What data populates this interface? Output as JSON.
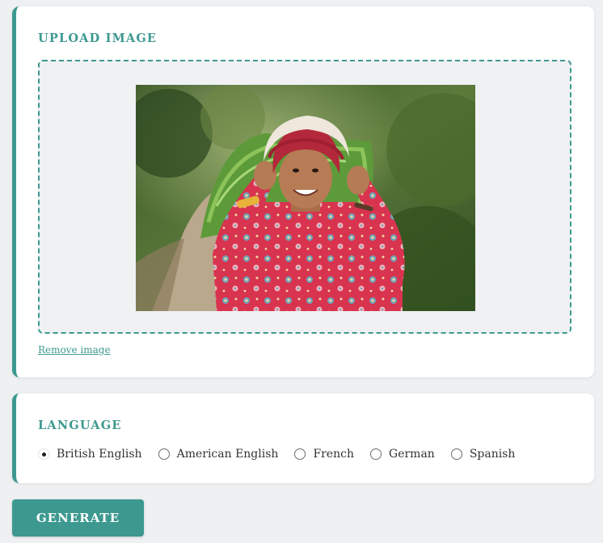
{
  "upload": {
    "title": "UPLOAD IMAGE",
    "image_alt": "Smiling woman in red floral dress and headscarf carrying a bundle of green grass on her back on a dirt path",
    "remove_label": "Remove image"
  },
  "language": {
    "title": "LANGUAGE",
    "selected": "British English",
    "options": [
      {
        "label": "British English",
        "checked": true
      },
      {
        "label": "American English",
        "checked": false
      },
      {
        "label": "French",
        "checked": false
      },
      {
        "label": "German",
        "checked": false
      },
      {
        "label": "Spanish",
        "checked": false
      }
    ]
  },
  "actions": {
    "generate_label": "GENERATE"
  },
  "colors": {
    "accent": "#3d9990",
    "page_background": "#eef0f2",
    "card_background": "#ffffff",
    "dropzone_background": "#eff1f3"
  }
}
